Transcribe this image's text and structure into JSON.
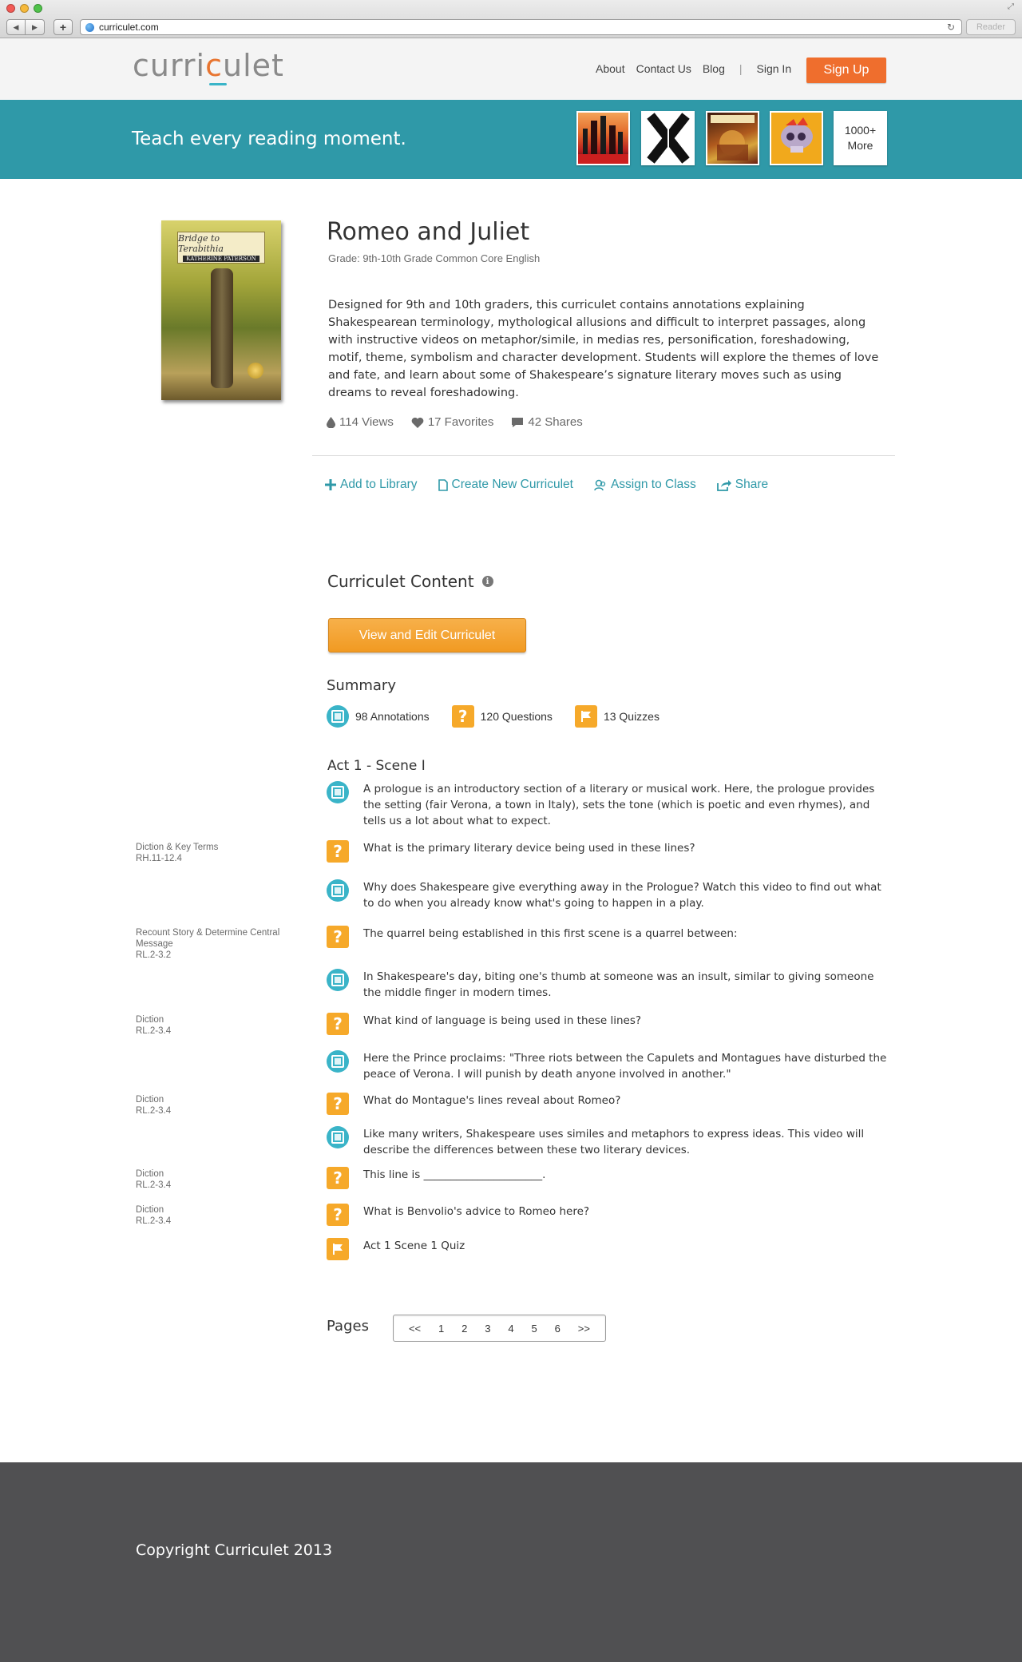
{
  "browser": {
    "url": "curriculet.com",
    "reader_label": "Reader",
    "back_glyph": "◀",
    "forward_glyph": "▶",
    "new_tab_glyph": "+",
    "reload_glyph": "↻",
    "resize_glyph": "⤢"
  },
  "header": {
    "logo_before": "curri",
    "logo_accent": "c",
    "logo_after": "ulet",
    "nav": [
      "About",
      "Contact Us",
      "Blog"
    ],
    "separator": "|",
    "sign_in": "Sign In",
    "sign_up": "Sign Up"
  },
  "hero": {
    "tagline": "Teach every reading moment.",
    "more_line1": "1000+",
    "more_line2": "More"
  },
  "book": {
    "title": "Romeo and Juliet",
    "grade": "Grade: 9th-10th Grade Common Core English",
    "description": "Designed for 9th and 10th graders, this curriculet contains annotations explaining Shakespearean terminology, mythological allusions and difficult to interpret passages, along with instructive videos on metaphor/simile, in medias res, personification, foreshadowing, motif, theme, symbolism and character development. Students will explore the themes of love and fate, and learn about some of Shakespeare’s signature literary moves such as using dreams to reveal foreshadowing.",
    "cover_title": "Bridge to Terabithia",
    "cover_author": "KATHERINE PATERSON",
    "views": "114 Views",
    "favorites": "17 Favorites",
    "shares": "42 Shares"
  },
  "actions": {
    "add": "Add to Library",
    "create": "Create New Curriculet",
    "assign": "Assign to Class",
    "share": "Share"
  },
  "content": {
    "title": "Curriculet Content",
    "info_glyph": "i",
    "view_edit": "View and Edit Curriculet",
    "summary_title": "Summary",
    "annotations": "98 Annotations",
    "questions": "120 Questions",
    "quizzes": "13 Quizzes",
    "question_glyph": "?",
    "act_title": "Act 1 - Scene I",
    "items": [
      {
        "type": "annotation",
        "text": "A prologue is an introductory section of a literary or musical work. Here, the prologue provides the setting (fair Verona, a town in Italy), sets the tone (which is poetic and even rhymes), and tells us a lot about what to expect."
      },
      {
        "type": "question",
        "text": "What is the primary literary device being used in these lines?",
        "std1": "Diction & Key Terms",
        "std2": "RH.11-12.4"
      },
      {
        "type": "annotation",
        "text": "Why does Shakespeare give everything away in the Prologue? Watch this video to find out what to do when you already know what's going to happen in a play."
      },
      {
        "type": "question",
        "text": "The quarrel being established in this first scene is a quarrel between:",
        "std1": "Recount Story & Determine Central Message",
        "std2": "RL.2-3.2"
      },
      {
        "type": "annotation",
        "text": "In Shakespeare's day, biting one's thumb at someone was an insult, similar to giving someone the middle finger in modern times."
      },
      {
        "type": "question",
        "text": "What kind of language is being used in these lines?",
        "std1": "Diction",
        "std2": "RL.2-3.4"
      },
      {
        "type": "annotation",
        "text": "Here the Prince proclaims: \"Three riots between the Capulets and Montagues have disturbed the peace of Verona. I will punish by death anyone involved in another.\""
      },
      {
        "type": "question",
        "text": "What do Montague's lines reveal about Romeo?",
        "std1": "Diction",
        "std2": "RL.2-3.4"
      },
      {
        "type": "annotation",
        "text": " Like many writers, Shakespeare uses similes and metaphors to express ideas. This video will describe the differences between these two literary devices."
      },
      {
        "type": "question",
        "text": "This line is  ______________________.",
        "std1": "Diction",
        "std2": "RL.2-3.4"
      },
      {
        "type": "question",
        "text": "What is Benvolio's advice to Romeo here?",
        "std1": "Diction",
        "std2": "RL.2-3.4"
      },
      {
        "type": "quiz",
        "text": "Act 1 Scene 1 Quiz"
      }
    ]
  },
  "pagination": {
    "label": "Pages",
    "prev": "<<",
    "pages": [
      "1",
      "2",
      "3",
      "4",
      "5",
      "6"
    ],
    "next": ">>"
  },
  "footer": {
    "copyright": "Copyright Curriculet 2013"
  },
  "colors": {
    "teal": "#2f99a8",
    "orange": "#ef6e2d",
    "question_orange": "#f6a92a",
    "footer": "#505052"
  }
}
